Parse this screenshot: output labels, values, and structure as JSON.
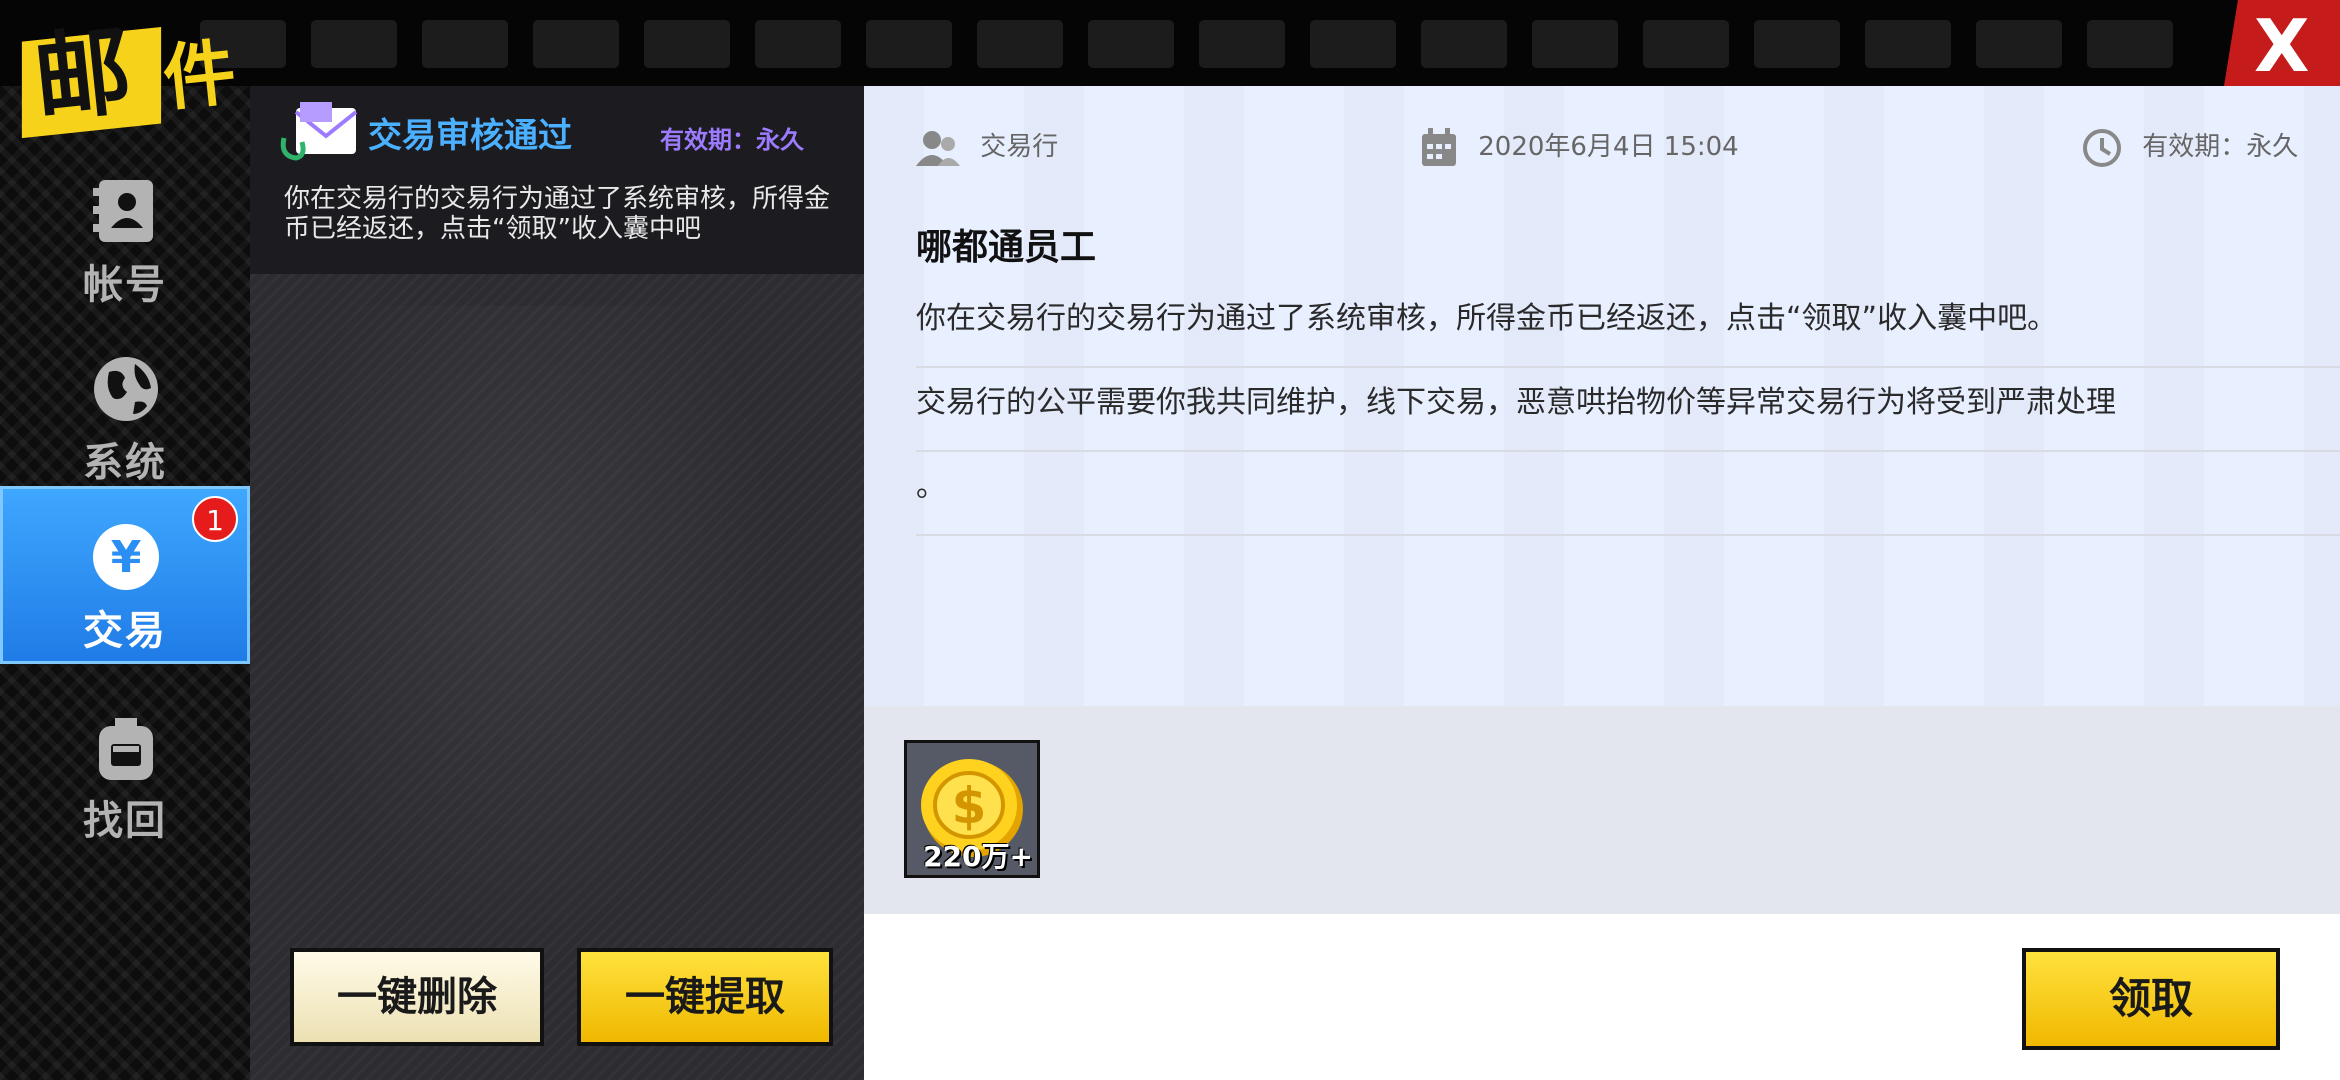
{
  "window": {
    "title": "邮件",
    "close_label": "X"
  },
  "nav": {
    "items": [
      {
        "label": "帐号",
        "icon": "account-card-icon",
        "active": false
      },
      {
        "label": "系统",
        "icon": "globe-icon",
        "active": false
      },
      {
        "label": "交易",
        "icon": "yen-coin-icon",
        "active": true,
        "badge": "1"
      },
      {
        "label": "找回",
        "icon": "backpack-icon",
        "active": false
      }
    ]
  },
  "mail_list": {
    "items": [
      {
        "title": "交易审核通过",
        "expiry": "有效期：永久",
        "preview": "你在交易行的交易行为通过了系统审核，所得金币已经返还，点击“领取”收入囊中吧"
      }
    ],
    "delete_all_label": "一键删除",
    "claim_all_label": "一键提取"
  },
  "detail": {
    "sender": "交易行",
    "date": "2020年6月4日  15:04",
    "expiry": "有效期：永久",
    "recipient": "哪都通员工",
    "body_lines": [
      "你在交易行的交易行为通过了系统审核，所得金币已经返还，点击“领取”收入囊中吧。",
      "交易行的公平需要你我共同维护，线下交易，恶意哄抬物价等异常交易行为将受到严肃处理",
      "。"
    ],
    "attachment": {
      "icon": "gold-coin-icon",
      "quantity": "220万+"
    },
    "claim_label": "领取"
  },
  "colors": {
    "accent_blue": "#2b8ef2",
    "button_yellow": "#f5c400",
    "badge_red": "#e61b1b",
    "title_blue": "#4ab0ff",
    "expiry_purple": "#9d7bff"
  }
}
